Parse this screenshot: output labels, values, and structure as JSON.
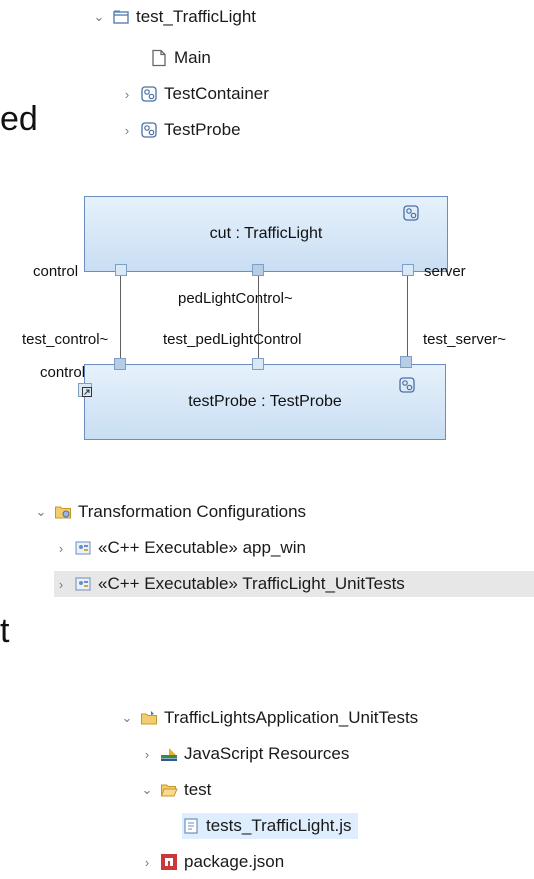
{
  "top_tree": {
    "root": {
      "label": "test_TrafficLight",
      "expanded": true
    },
    "children": [
      {
        "label": "Main",
        "icon": "file-icon"
      },
      {
        "label": "TestContainer",
        "icon": "capsule-icon"
      },
      {
        "label": "TestProbe",
        "icon": "capsule-icon"
      }
    ]
  },
  "slide_fragments": [
    "ed",
    "t"
  ],
  "diagram": {
    "cut_part": "cut : TrafficLight",
    "probe_part": "testProbe : TestProbe",
    "top_ports": [
      "control",
      "pedLightControl~",
      "server"
    ],
    "bottom_ports": [
      "test_control~",
      "test_pedLightControl",
      "test_server~"
    ],
    "probe_port": "control"
  },
  "transform_tree": {
    "root": "Transformation Configurations",
    "items": [
      "«C++ Executable» app_win",
      "«C++ Executable» TrafficLight_UnitTests"
    ]
  },
  "project_tree": {
    "root": "TrafficLightsApplication_UnitTests",
    "items": [
      {
        "label": "JavaScript Resources",
        "level": 1,
        "expanded": false
      },
      {
        "label": "test",
        "level": 1,
        "expanded": true
      },
      {
        "label": "tests_TrafficLight.js",
        "level": 2
      },
      {
        "label": "package.json",
        "level": 1,
        "expanded": false
      }
    ]
  },
  "colors": {
    "accent_blue": "#6c8ebf",
    "folder_yellow": "#e8b84a",
    "npm_red": "#cb3837",
    "selection_grey": "#e7e7e7",
    "selection_blue": "#dfeeff"
  }
}
